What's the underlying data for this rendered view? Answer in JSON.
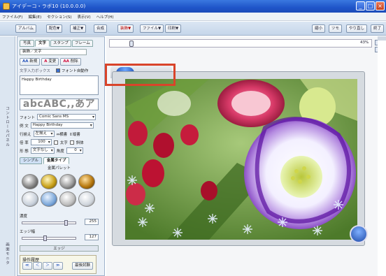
{
  "titlebar": {
    "title": "アイデーコ・ラボ10 (10.0.0.0)"
  },
  "menu": [
    "ファイル(F)",
    "編集(E)",
    "セクション(S)",
    "表示(V)",
    "ヘルプ(H)"
  ],
  "toolbar": {
    "left": [
      "アルバム",
      "配色▼",
      "補正▼",
      "合成",
      "装飾▼",
      "ファイル▼",
      "印刷▼"
    ],
    "right": [
      "縮小",
      "ツモ",
      "やり直し",
      "終了"
    ]
  },
  "sidebar": {
    "vertical_label": "コントロールパネル",
    "vertical_label2": "画面モニタ"
  },
  "panel": {
    "tabs": [
      "写真",
      "文字",
      "スタンプ",
      "フレーム"
    ],
    "section_label": "装飾／文字",
    "actions": {
      "new": "新規",
      "edit": "変更",
      "delete": "削除"
    },
    "input_label": "文字入力ボックス",
    "font_check_label": "フォント自動作",
    "text_value": "Happy Birthday",
    "preview_text": "abcABC,,あア",
    "font_label": "フォント",
    "font_value": "Comic Sans MS",
    "string_label": "例 文",
    "string_value": "Happy Birthday",
    "line_label": "行揃え",
    "line_value": "左揃え",
    "horizontal_label": "横書",
    "vertical_label": "縦書",
    "size_label": "倍 率",
    "size_value": "100",
    "bold_label": "太字",
    "italic_label": "斜体",
    "shape_label": "形 態",
    "shape_value": "文字なし",
    "angle_label": "角度",
    "angle_value": "0",
    "subtab1": "シンプル",
    "subtab2": "金属タイプ",
    "palette_title": "金属パレット",
    "opacity_label": "濃度",
    "opacity_value": "255",
    "edge_label": "エッジ幅",
    "edge_value": "127",
    "edge2_label": "エッジ",
    "history_label": "操作履歴",
    "history_btn": "最後試験"
  },
  "canvas": {
    "zoom": "43%"
  },
  "colors": {
    "title": "#2a5fd3",
    "highlight": "#d9442a"
  }
}
